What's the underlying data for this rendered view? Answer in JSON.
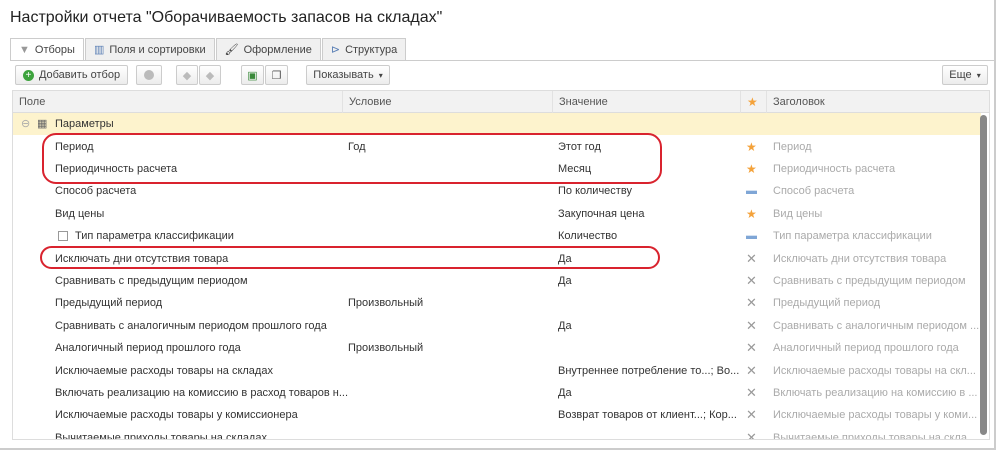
{
  "title": "Настройки отчета \"Оборачиваемость запасов на складах\"",
  "tabs": [
    {
      "label": "Отборы",
      "icon": "filter-icon"
    },
    {
      "label": "Поля и сортировки",
      "icon": "fields-icon"
    },
    {
      "label": "Оформление",
      "icon": "brush-icon"
    },
    {
      "label": "Структура",
      "icon": "structure-icon"
    }
  ],
  "toolbar": {
    "add_filter": "Добавить отбор",
    "show": "Показывать",
    "more": "Еще"
  },
  "columns": {
    "field": "Поле",
    "condition": "Условие",
    "value": "Значение",
    "title": "Заголовок"
  },
  "group": "Параметры",
  "rows": [
    {
      "field": "Период",
      "condition": "Год",
      "value": "Этот год",
      "mark": "star",
      "title": "Период"
    },
    {
      "field": "Периодичность расчета",
      "condition": "",
      "value": "Месяц",
      "mark": "star",
      "title": "Периодичность расчета"
    },
    {
      "field": "Способ расчета",
      "condition": "",
      "value": "По количеству",
      "mark": "dash",
      "title": "Способ расчета"
    },
    {
      "field": "Вид цены",
      "condition": "",
      "value": "Закупочная цена",
      "mark": "star",
      "title": "Вид цены"
    },
    {
      "field": "Тип параметра классификации",
      "condition": "",
      "value": "Количество",
      "mark": "dash",
      "title": "Тип параметра классификации",
      "checkbox": true
    },
    {
      "field": "Исключать дни отсутствия товара",
      "condition": "",
      "value": "Да",
      "mark": "x",
      "title": "Исключать дни отсутствия товара"
    },
    {
      "field": "Сравнивать с предыдущим периодом",
      "condition": "",
      "value": "Да",
      "mark": "x",
      "title": "Сравнивать с предыдущим периодом"
    },
    {
      "field": "Предыдущий период",
      "condition": "Произвольный",
      "value": "",
      "mark": "x",
      "title": "Предыдущий период"
    },
    {
      "field": "Сравнивать с аналогичным периодом прошлого года",
      "condition": "",
      "value": "Да",
      "mark": "x",
      "title": "Сравнивать с аналогичным периодом ..."
    },
    {
      "field": "Аналогичный период прошлого года",
      "condition": "Произвольный",
      "value": "",
      "mark": "x",
      "title": "Аналогичный период прошлого года"
    },
    {
      "field": "Исключаемые расходы товары на складах",
      "condition": "",
      "value": "Внутреннее потребление то...; Во...",
      "mark": "x",
      "title": "Исключаемые расходы товары на скл..."
    },
    {
      "field": "Включать реализацию на комиссию в расход товаров н...",
      "condition": "",
      "value": "Да",
      "mark": "x",
      "title": "Включать реализацию на комиссию в ..."
    },
    {
      "field": "Исключаемые расходы товары у комиссионера",
      "condition": "",
      "value": "Возврат товаров от клиент...; Кор...",
      "mark": "x",
      "title": "Исключаемые расходы товары у коми..."
    },
    {
      "field": "Вычитаемые приходы товары на складах",
      "condition": "",
      "value": "",
      "mark": "x",
      "title": "Вычитаемые приходы товары на скла..."
    }
  ],
  "colors": {
    "highlight": "#d9232e",
    "group_bg": "#fdf3cd",
    "star": "#f4a23a"
  }
}
